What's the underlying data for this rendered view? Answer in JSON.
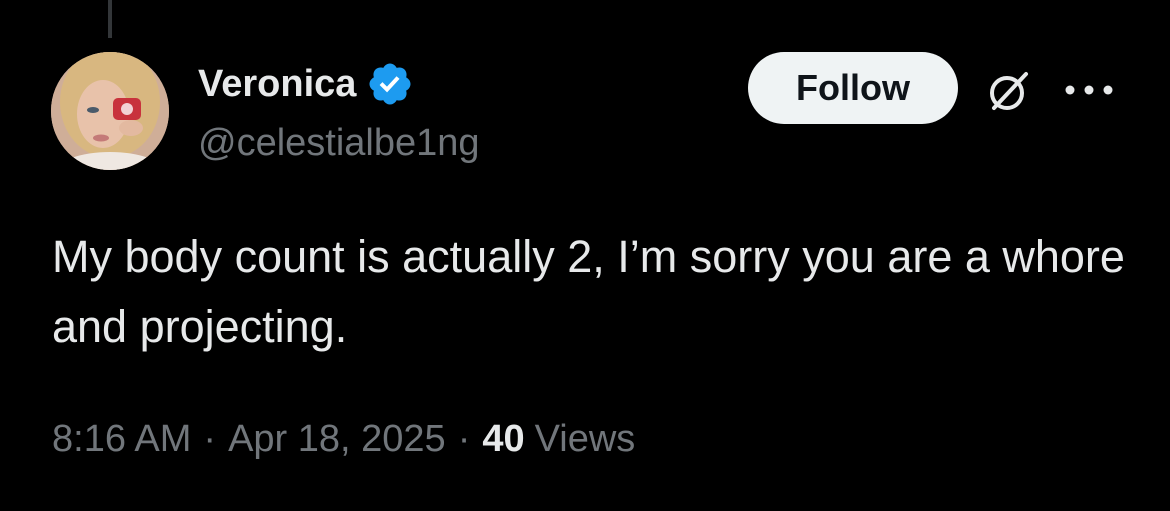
{
  "author": {
    "display_name": "Veronica",
    "handle": "@celestialbe1ng",
    "verified": true,
    "verified_badge_color": "#1d9bf0"
  },
  "actions": {
    "follow_label": "Follow",
    "grok_icon": "grok-slash-circle-icon",
    "more_icon": "ellipsis-icon"
  },
  "tweet": {
    "text": "My body count is actually 2, I’m sorry you are a whore and projecting.",
    "time": "8:16 AM",
    "separator": "·",
    "date": "Apr 18, 2025",
    "views_count": "40",
    "views_label": "Views"
  },
  "colors": {
    "background": "#000000",
    "primary_text": "#e7e9ea",
    "secondary_text": "#71767b",
    "follow_button_bg": "#eff3f4",
    "thread_line": "#333639"
  }
}
